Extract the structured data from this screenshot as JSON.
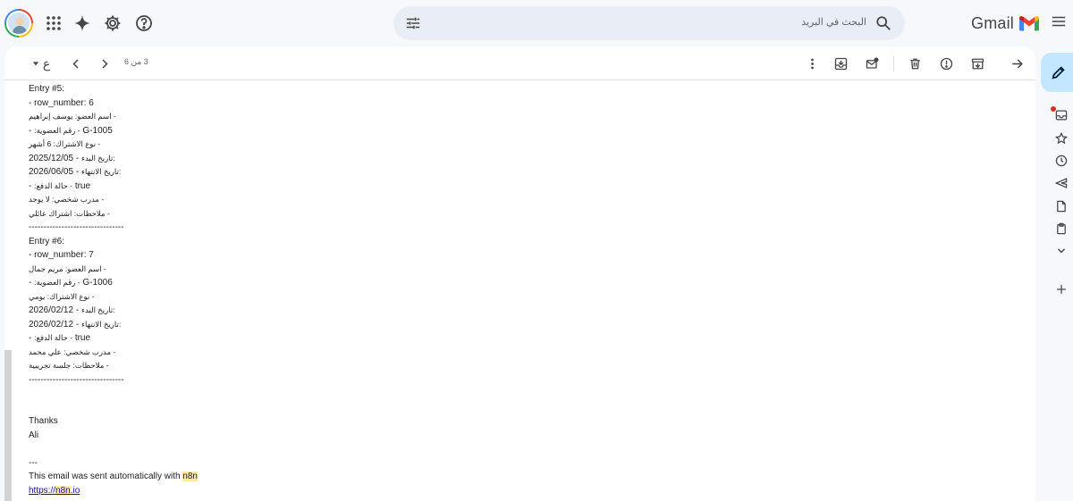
{
  "header": {
    "search_placeholder": "البحث في البريد",
    "app_name": "Gmail"
  },
  "toolbar": {
    "counter": "3 من 6",
    "language_menu": "ع"
  },
  "email": {
    "entry5": {
      "title": "Entry #5:",
      "row_number": "- row_number: 6",
      "member_name": "اسم العضو: يوسف إبراهيم -",
      "member_id_label": ":رقم العضوية -",
      "member_id_value": "G-1005",
      "sub_type": "نوع الاشتراك: 6 أشهر -",
      "start_label": "تاريخ البدء:",
      "start_value": "2025/12/05 -",
      "end_label": "تاريخ الانتهاء:",
      "end_value": "2026/06/05 -",
      "paid_label": ":حالة الدفع -",
      "paid_value": "true",
      "trainer": "مدرب شخصي: لا يوجد -",
      "notes": "ملاحظات: اشتراك عائلي -"
    },
    "divider": "--------------------------------",
    "entry6": {
      "title": "Entry #6:",
      "row_number": "- row_number: 7",
      "member_name": "اسم العضو: مريم جمال -",
      "member_id_label": ":رقم العضوية -",
      "member_id_value": "G-1006",
      "sub_type": "نوع الاشتراك: يومي -",
      "start_label": "تاريخ البدء:",
      "start_value": "2026/02/12 -",
      "end_label": "تاريخ الانتهاء:",
      "end_value": "2026/02/12 -",
      "paid_label": ":حالة الدفع -",
      "paid_value": "true",
      "trainer": "مدرب شخصي: علي محمد -",
      "notes": "ملاحظات: جلسة تجريبية -"
    },
    "thanks": "Thanks",
    "signature": "Ali",
    "sig_separator": "---",
    "footer_prefix": "This email was sent automatically with ",
    "footer_highlight": "n8n",
    "link_prefix": "https://",
    "link_highlight": "n8n",
    "link_suffix": ".io"
  }
}
